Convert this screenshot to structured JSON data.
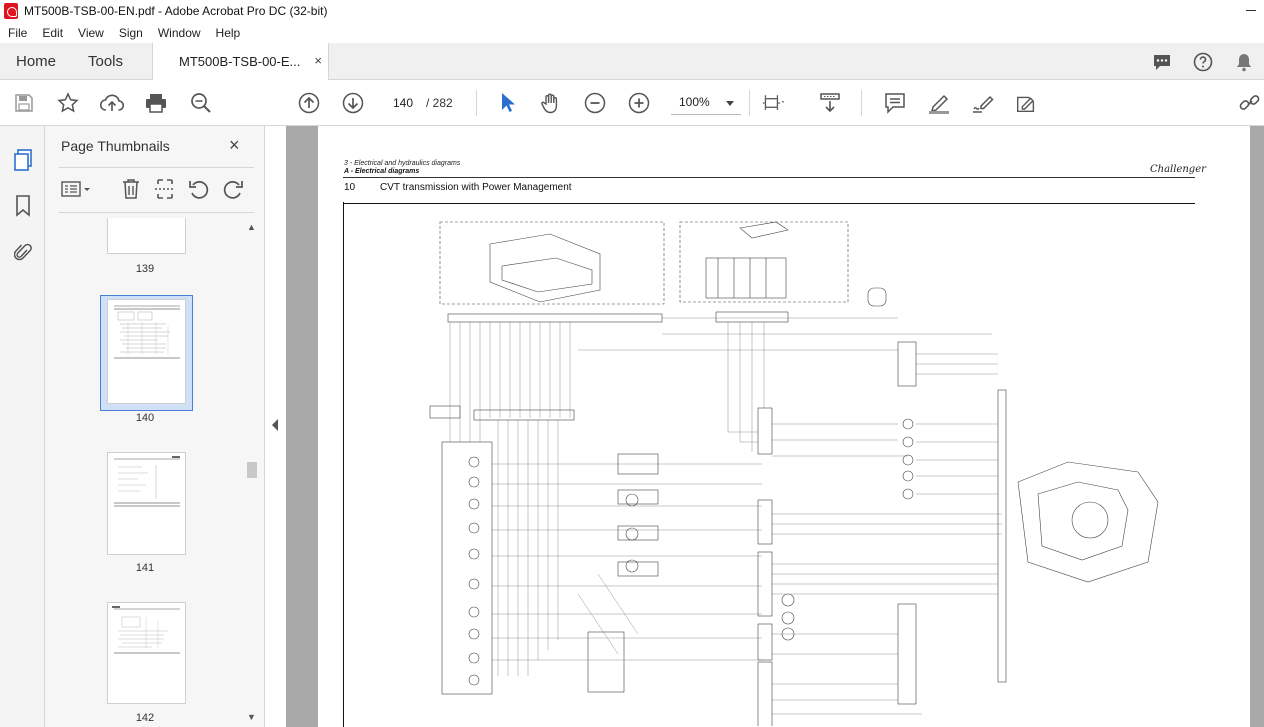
{
  "window": {
    "title": "MT500B-TSB-00-EN.pdf - Adobe Acrobat Pro DC (32-bit)"
  },
  "menu": [
    "File",
    "Edit",
    "View",
    "Sign",
    "Window",
    "Help"
  ],
  "tabs": {
    "home": "Home",
    "tools": "Tools",
    "document": "MT500B-TSB-00-E...",
    "document_close": "×"
  },
  "toolbar": {
    "current_page": "140",
    "total_pages": "/ 282",
    "zoom": "100%"
  },
  "thumbnails_panel": {
    "title": "Page Thumbnails",
    "close": "×",
    "pages": [
      {
        "label": "139",
        "selected": false
      },
      {
        "label": "140",
        "selected": true
      },
      {
        "label": "141",
        "selected": false
      },
      {
        "label": "142",
        "selected": false
      }
    ]
  },
  "page": {
    "section": "3 - Electrical and hydraulics diagrams",
    "subsection": "A - Electrical diagrams",
    "number": "10",
    "heading": "CVT transmission with Power Management",
    "brand": "Challenger"
  },
  "colors": {
    "accent_blue": "#2d6fcf",
    "selection": "#cfe0f7",
    "pdf_red": "#e0141e",
    "canvas_gray": "#a9a9a9"
  }
}
